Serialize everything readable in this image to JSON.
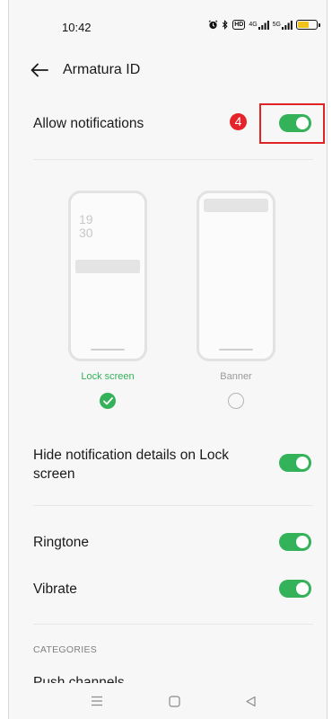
{
  "status_bar": {
    "time": "10:42",
    "icons": [
      "alarm-icon",
      "bluetooth-icon",
      "hd-voice-icon",
      "signal-4g-icon",
      "signal-5g-icon",
      "battery-icon"
    ],
    "hd_label": "HD",
    "signal1_label": "4G",
    "signal2_label": "5G"
  },
  "header": {
    "title": "Armatura ID",
    "back_icon": "arrow-left-icon"
  },
  "allow_notifications": {
    "label": "Allow notifications",
    "badge": "4",
    "enabled": true
  },
  "preview": {
    "lock_screen": {
      "caption": "Lock screen",
      "clock_hour": "19",
      "clock_minute": "30",
      "selected": true
    },
    "banner": {
      "caption": "Banner",
      "selected": false
    }
  },
  "settings": {
    "hide_details": {
      "label": "Hide notification details on Lock screen",
      "enabled": true
    },
    "ringtone": {
      "label": "Ringtone",
      "enabled": true
    },
    "vibrate": {
      "label": "Vibrate",
      "enabled": true
    }
  },
  "categories": {
    "header": "CATEGORIES",
    "partial_item": "Push channels"
  },
  "nav_bar": {
    "icons": [
      "menu-icon",
      "home-icon",
      "back-triangle-icon"
    ]
  },
  "colors": {
    "accent_green": "#34b25a",
    "badge_red": "#e5232a",
    "highlight_red": "#e02424",
    "battery_yellow": "#f2c31a"
  }
}
